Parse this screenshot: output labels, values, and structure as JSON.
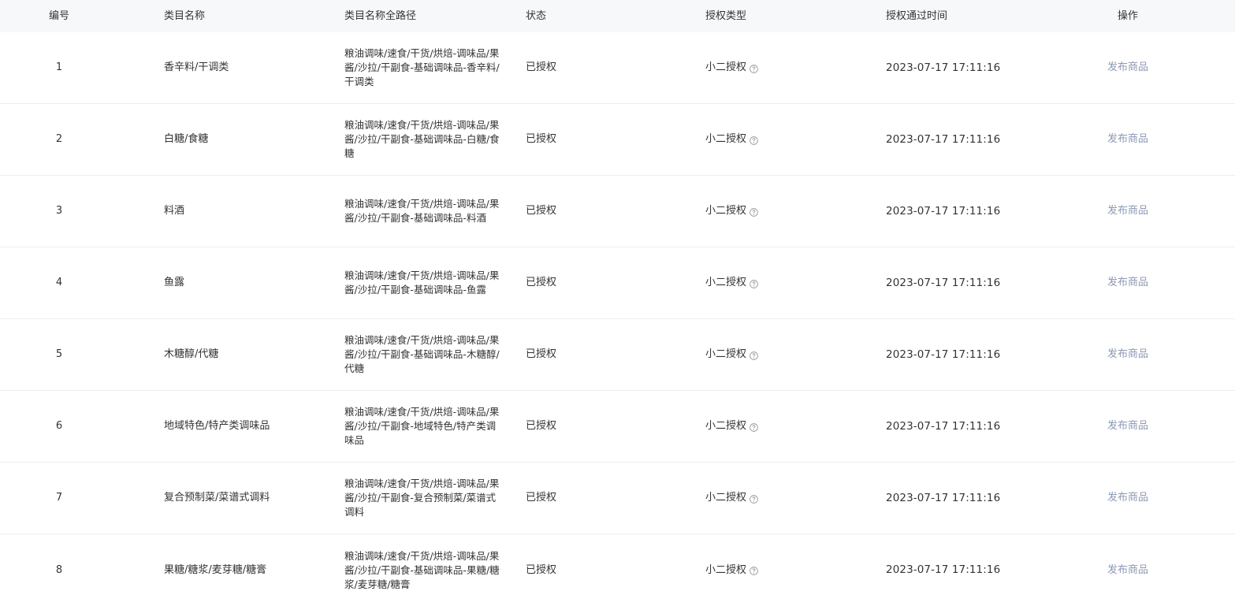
{
  "columns": {
    "no": "编号",
    "name": "类目名称",
    "path": "类目名称全路径",
    "status": "状态",
    "auth_type": "授权类型",
    "auth_time": "授权通过时间",
    "operation": "操作"
  },
  "icons": {
    "help": "question-circle-icon"
  },
  "colors": {
    "header_bg": "#f7f8fa",
    "link": "#8c99b3",
    "text": "#333333"
  },
  "rows": [
    {
      "no": "1",
      "name": "香辛料/干调类",
      "path": "粮油调味/速食/干货/烘焙-调味品/果酱/沙拉/干副食-基础调味品-香辛料/干调类",
      "status": "已授权",
      "auth_type": "小二授权",
      "auth_time": "2023-07-17 17:11:16",
      "action": "发布商品"
    },
    {
      "no": "2",
      "name": "白糖/食糖",
      "path": "粮油调味/速食/干货/烘焙-调味品/果酱/沙拉/干副食-基础调味品-白糖/食糖",
      "status": "已授权",
      "auth_type": "小二授权",
      "auth_time": "2023-07-17 17:11:16",
      "action": "发布商品"
    },
    {
      "no": "3",
      "name": "料酒",
      "path": "粮油调味/速食/干货/烘焙-调味品/果酱/沙拉/干副食-基础调味品-料酒",
      "status": "已授权",
      "auth_type": "小二授权",
      "auth_time": "2023-07-17 17:11:16",
      "action": "发布商品"
    },
    {
      "no": "4",
      "name": "鱼露",
      "path": "粮油调味/速食/干货/烘焙-调味品/果酱/沙拉/干副食-基础调味品-鱼露",
      "status": "已授权",
      "auth_type": "小二授权",
      "auth_time": "2023-07-17 17:11:16",
      "action": "发布商品"
    },
    {
      "no": "5",
      "name": "木糖醇/代糖",
      "path": "粮油调味/速食/干货/烘焙-调味品/果酱/沙拉/干副食-基础调味品-木糖醇/代糖",
      "status": "已授权",
      "auth_type": "小二授权",
      "auth_time": "2023-07-17 17:11:16",
      "action": "发布商品"
    },
    {
      "no": "6",
      "name": "地域特色/特产类调味品",
      "path": "粮油调味/速食/干货/烘焙-调味品/果酱/沙拉/干副食-地域特色/特产类调味品",
      "status": "已授权",
      "auth_type": "小二授权",
      "auth_time": "2023-07-17 17:11:16",
      "action": "发布商品"
    },
    {
      "no": "7",
      "name": "复合预制菜/菜谱式调料",
      "path": "粮油调味/速食/干货/烘焙-调味品/果酱/沙拉/干副食-复合预制菜/菜谱式调料",
      "status": "已授权",
      "auth_type": "小二授权",
      "auth_time": "2023-07-17 17:11:16",
      "action": "发布商品"
    },
    {
      "no": "8",
      "name": "果糖/糖浆/麦芽糖/糖膏",
      "path": "粮油调味/速食/干货/烘焙-调味品/果酱/沙拉/干副食-基础调味品-果糖/糖浆/麦芽糖/糖膏",
      "status": "已授权",
      "auth_type": "小二授权",
      "auth_time": "2023-07-17 17:11:16",
      "action": "发布商品"
    }
  ]
}
